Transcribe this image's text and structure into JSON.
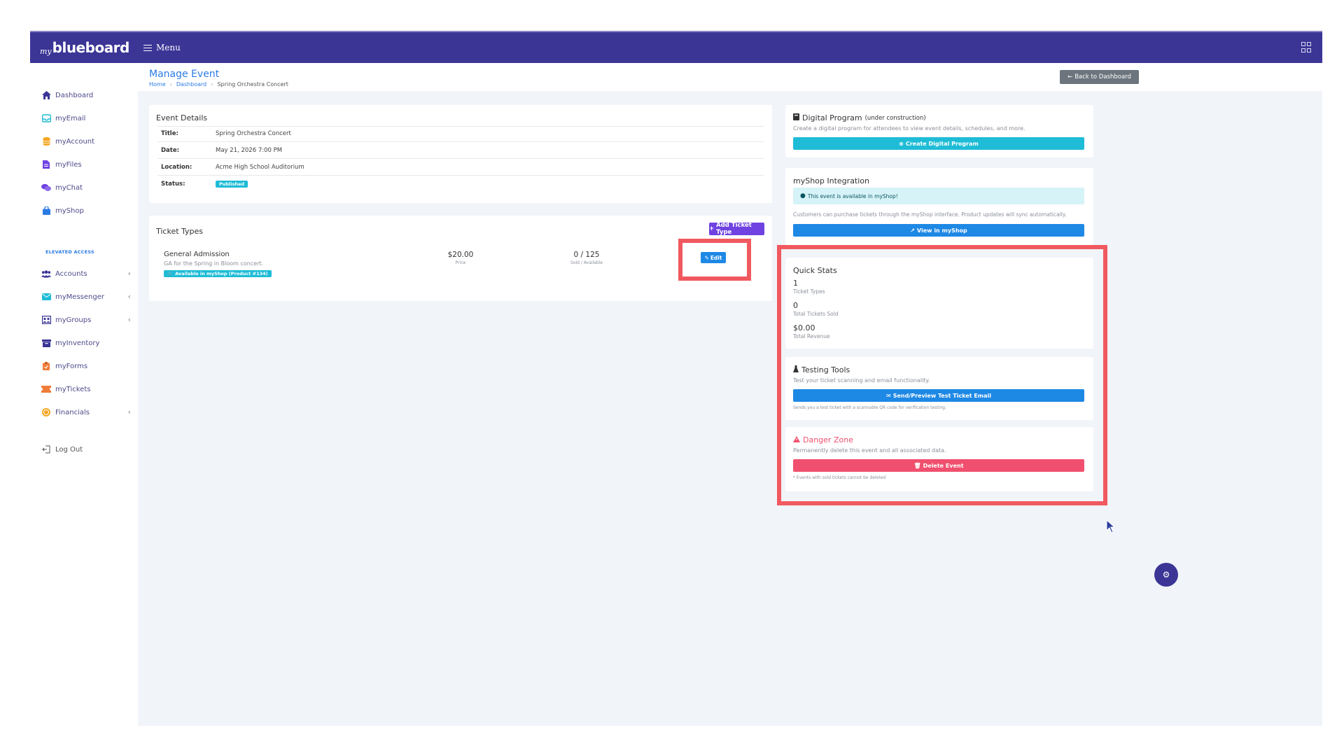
{
  "brand": {
    "prefix": "my",
    "name": "blueboard"
  },
  "navbar": {
    "menu_label": "Menu"
  },
  "sidebar": {
    "items": [
      {
        "label": "Dashboard",
        "icon": "home-icon"
      },
      {
        "label": "myEmail",
        "icon": "inbox-icon"
      },
      {
        "label": "myAccount",
        "icon": "database-icon"
      },
      {
        "label": "myFiles",
        "icon": "file-icon"
      },
      {
        "label": "myChat",
        "icon": "chat-icon"
      },
      {
        "label": "myShop",
        "icon": "shopping-bag-icon"
      }
    ],
    "section_header": "ELEVATED ACCESS",
    "elevated_items": [
      {
        "label": "Accounts",
        "icon": "users-icon"
      },
      {
        "label": "myMessenger",
        "icon": "envelope-icon"
      },
      {
        "label": "myGroups",
        "icon": "groups-icon"
      },
      {
        "label": "myInventory",
        "icon": "archive-icon"
      },
      {
        "label": "myForms",
        "icon": "clipboard-icon"
      },
      {
        "label": "myTickets",
        "icon": "ticket-icon"
      },
      {
        "label": "Financials",
        "icon": "coin-icon"
      }
    ],
    "logout_label": "Log Out"
  },
  "header": {
    "title": "Manage Event",
    "breadcrumb": [
      "Home",
      "Dashboard",
      "Spring Orchestra Concert"
    ],
    "back_label": "Back to Dashboard"
  },
  "event_details": {
    "title": "Event Details",
    "rows": [
      {
        "label": "Title:",
        "value": "Spring Orchestra Concert"
      },
      {
        "label": "Date:",
        "value": "May 21, 2026 7:00 PM"
      },
      {
        "label": "Location:",
        "value": "Acme High School Auditorium"
      },
      {
        "label": "Status:",
        "value": "Published"
      }
    ]
  },
  "ticket_types": {
    "title": "Ticket Types",
    "add_label": "Add Ticket Type",
    "items": [
      {
        "name": "General Admission",
        "description": "GA for the Spring in Bloom concert.",
        "shop_badge": "Available in myShop (Product #134)",
        "price": "$20.00",
        "price_label": "Price",
        "sold": "0 / 125",
        "sold_label": "Sold / Available",
        "edit_label": "Edit"
      }
    ]
  },
  "digital_program": {
    "title": "Digital Program",
    "title_note": "(under construction)",
    "description": "Create a digital program for attendees to view event details, schedules, and more.",
    "button_label": "Create Digital Program"
  },
  "myshop_integration": {
    "title": "myShop Integration",
    "alert": "This event is available in myShop!",
    "description": "Customers can purchase tickets through the myShop interface. Product updates will sync automatically.",
    "button_label": "View in myShop"
  },
  "quick_stats": {
    "title": "Quick Stats",
    "stats": [
      {
        "value": "1",
        "label": "Ticket Types"
      },
      {
        "value": "0",
        "label": "Total Tickets Sold"
      },
      {
        "value": "$0.00",
        "label": "Total Revenue"
      }
    ]
  },
  "testing_tools": {
    "title": "Testing Tools",
    "description": "Test your ticket scanning and email functionality.",
    "button_label": "Send/Preview Test Ticket Email",
    "note": "Sends you a test ticket with a scannable QR code for verification testing."
  },
  "danger_zone": {
    "title": "Danger Zone",
    "description": "Permanently delete this event and all associated data.",
    "button_label": "Delete Event",
    "note": "* Events with sold tickets cannot be deleted"
  },
  "colors": {
    "navbar": "#3b3596",
    "link": "#2c7be5",
    "info": "#1ebcd6",
    "primary": "#1e88e5",
    "purple": "#6f42e1",
    "danger": "#f0506e",
    "highlight": "#f0595f"
  }
}
